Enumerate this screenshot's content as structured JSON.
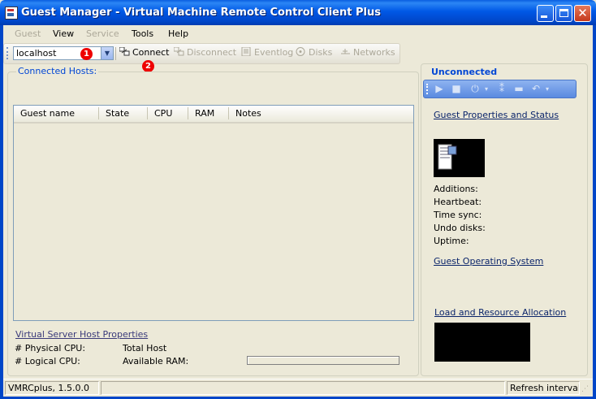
{
  "window": {
    "title": "Guest Manager - Virtual Machine Remote Control Client Plus"
  },
  "menu": {
    "items": [
      {
        "label": "Guest",
        "enabled": false
      },
      {
        "label": "View",
        "enabled": true
      },
      {
        "label": "Service",
        "enabled": false
      },
      {
        "label": "Tools",
        "enabled": true
      },
      {
        "label": "Help",
        "enabled": true
      }
    ]
  },
  "toolbar": {
    "host_combo_value": "localhost",
    "connect": "Connect",
    "disconnect": "Disconnect",
    "eventlog": "Eventlog",
    "disks": "Disks",
    "networks": "Networks",
    "marker1": "1",
    "marker2": "2"
  },
  "hosts": {
    "group_title": "Connected Hosts:",
    "columns": [
      "Guest name",
      "State",
      "CPU",
      "RAM",
      "Notes"
    ],
    "rows": []
  },
  "host_properties": {
    "link": "Virtual Server Host Properties",
    "physical_cpu_label": "# Physical CPU:",
    "logical_cpu_label": "# Logical CPU:",
    "total_host_label": "Total Host RAM:",
    "available_ram_label": "Available RAM:"
  },
  "guest_panel": {
    "status": "Unconnected",
    "properties_link": "Guest Properties and Status",
    "additions_label": "Additions:",
    "heartbeat_label": "Heartbeat:",
    "time_sync_label": "Time sync:",
    "undo_disks_label": "Undo disks:",
    "uptime_label": "Uptime:",
    "os_link": "Guest Operating System",
    "load_link": "Load and Resource Allocation"
  },
  "statusbar": {
    "version": "VMRCplus, 1.5.0.0",
    "refresh": "Refresh interval:"
  },
  "colors": {
    "titlebar": "#0058e6",
    "accent_text": "#0046d5",
    "marker": "#e00000"
  }
}
